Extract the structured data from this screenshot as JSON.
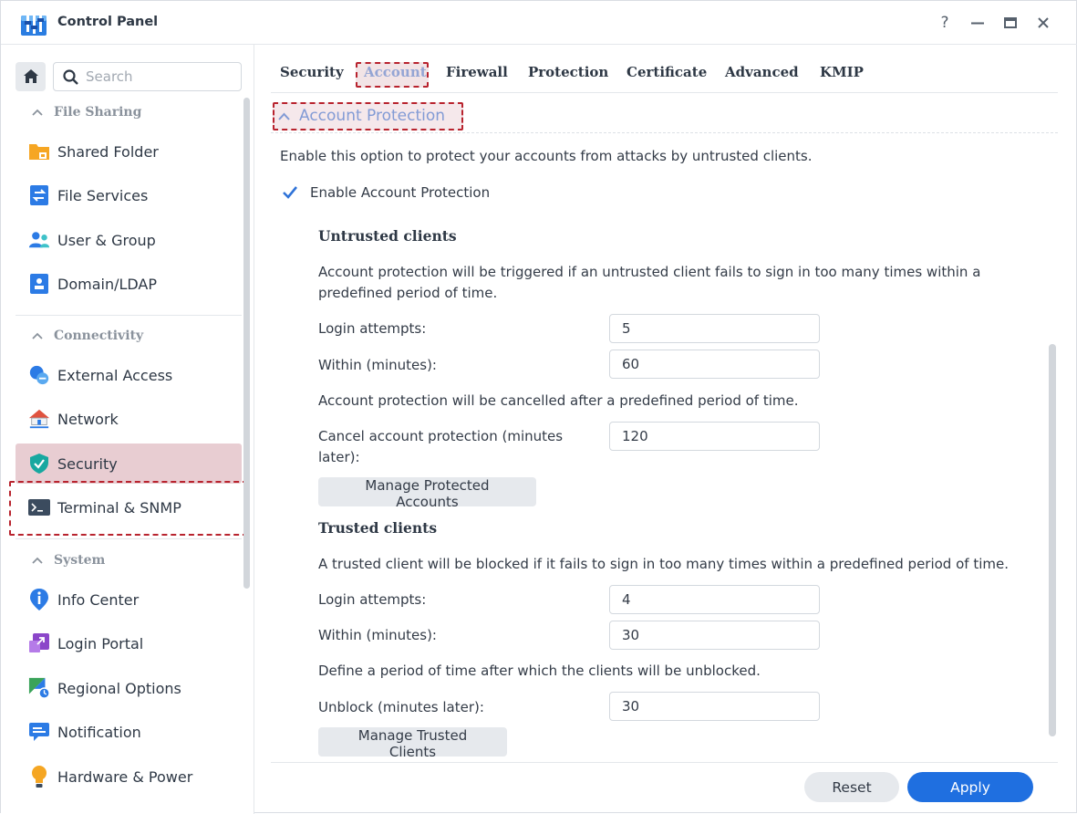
{
  "window": {
    "title": "Control Panel",
    "help_label": "?"
  },
  "colors": {
    "accent": "#2f73d8",
    "primary_button": "#1f6fe0",
    "active_item_bg": "#e8cdd2",
    "highlight_border": "#b8232e"
  },
  "sidebar": {
    "search_placeholder": "Search",
    "groups": [
      {
        "label": "File Sharing",
        "items": [
          {
            "label": "Shared Folder",
            "icon": "folder-icon"
          },
          {
            "label": "File Services",
            "icon": "file-services-icon"
          },
          {
            "label": "User & Group",
            "icon": "users-icon"
          },
          {
            "label": "Domain/LDAP",
            "icon": "id-card-icon"
          }
        ]
      },
      {
        "label": "Connectivity",
        "items": [
          {
            "label": "External Access",
            "icon": "globe-link-icon"
          },
          {
            "label": "Network",
            "icon": "house-network-icon"
          },
          {
            "label": "Security",
            "icon": "shield-icon",
            "active": true
          },
          {
            "label": "Terminal & SNMP",
            "icon": "terminal-icon"
          }
        ]
      },
      {
        "label": "System",
        "items": [
          {
            "label": "Info Center",
            "icon": "info-icon"
          },
          {
            "label": "Login Portal",
            "icon": "login-portal-icon"
          },
          {
            "label": "Regional Options",
            "icon": "regional-icon"
          },
          {
            "label": "Notification",
            "icon": "notification-icon"
          },
          {
            "label": "Hardware & Power",
            "icon": "bulb-icon"
          }
        ]
      }
    ]
  },
  "tabs": [
    {
      "label": "Security"
    },
    {
      "label": "Account",
      "active": true
    },
    {
      "label": "Firewall"
    },
    {
      "label": "Protection"
    },
    {
      "label": "Certificate"
    },
    {
      "label": "Advanced"
    },
    {
      "label": "KMIP"
    }
  ],
  "content": {
    "section_title": "Account Protection",
    "intro": "Enable this option to protect your accounts from attacks by untrusted clients.",
    "enable_label": "Enable Account Protection",
    "enable_checked": true,
    "untrusted": {
      "heading": "Untrusted clients",
      "desc": "Account protection will be triggered if an untrusted client fails to sign in too many times within a predefined period of time.",
      "login_attempts_label": "Login attempts:",
      "login_attempts_value": "5",
      "within_label": "Within (minutes):",
      "within_value": "60",
      "cancel_desc": "Account protection will be cancelled after a predefined period of time.",
      "cancel_label": "Cancel account protection (minutes later):",
      "cancel_value": "120",
      "manage_button": "Manage Protected Accounts"
    },
    "trusted": {
      "heading": "Trusted clients",
      "desc": "A trusted client will be blocked if it fails to sign in too many times within a predefined period of time.",
      "login_attempts_label": "Login attempts:",
      "login_attempts_value": "4",
      "within_label": "Within (minutes):",
      "within_value": "30",
      "unblock_desc": "Define a period of time after which the clients will be unblocked.",
      "unblock_label": "Unblock (minutes later):",
      "unblock_value": "30",
      "manage_button": "Manage Trusted Clients"
    }
  },
  "footer": {
    "reset_label": "Reset",
    "apply_label": "Apply"
  }
}
